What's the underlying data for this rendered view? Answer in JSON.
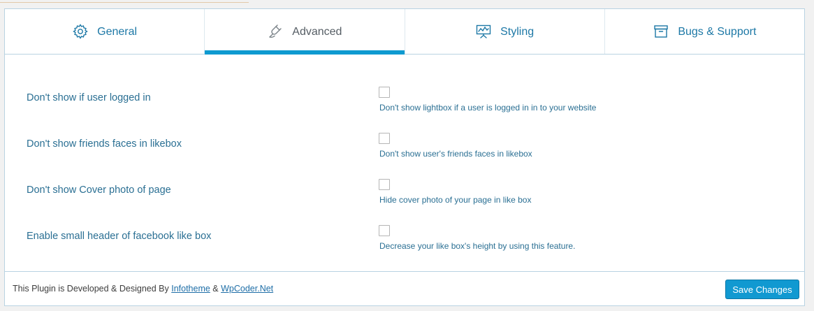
{
  "tabs": [
    {
      "label": "General",
      "icon": "gear-icon",
      "active": false
    },
    {
      "label": "Advanced",
      "icon": "plug-icon",
      "active": true
    },
    {
      "label": "Styling",
      "icon": "presentation-board-icon",
      "active": false
    },
    {
      "label": "Bugs & Support",
      "icon": "archive-box-icon",
      "active": false
    }
  ],
  "settings": [
    {
      "label": "Don't show if user logged in",
      "checked": false,
      "description": "Don't show lightbox if a user is logged in in to your website"
    },
    {
      "label": "Don't show friends faces in likebox",
      "checked": false,
      "description": "Don't show user's friends faces in likebox"
    },
    {
      "label": "Don't show Cover photo of page",
      "checked": false,
      "description": "Hide cover photo of your page in like box"
    },
    {
      "label": "Enable small header of facebook like box",
      "checked": false,
      "description": "Decrease your like box's height by using this feature."
    }
  ],
  "footer": {
    "credit_prefix": "This Plugin is Developed & Designed By ",
    "link1": "Infotheme",
    "separator": " & ",
    "link2": "WpCoder.Net",
    "save_label": "Save Changes"
  },
  "colors": {
    "accent": "#0e9ad0",
    "text": "#2a6f93",
    "button": "#1199d1"
  }
}
